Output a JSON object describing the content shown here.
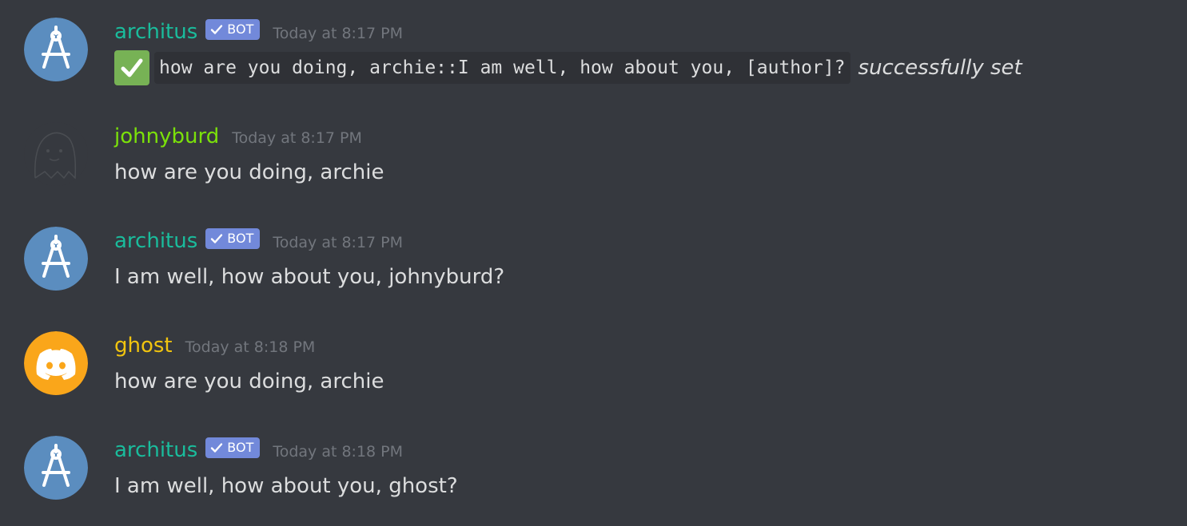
{
  "colors": {
    "background": "#36393f",
    "architus": "#1abc9c",
    "johnyburd": "#7be10a",
    "ghost": "#f1c40f",
    "bot_tag": "#7289da",
    "timestamp": "#72767d",
    "avatar_blue": "#5b8dbf",
    "avatar_orange": "#faa61a"
  },
  "messages": [
    {
      "author": "architus",
      "bot_tag": "BOT",
      "timestamp": "Today at 8:17 PM",
      "avatar_icon": "compass-icon",
      "code": "how are you doing, archie::I am well, how about you, [author]?",
      "suffix": "successfully set",
      "emoji": "white-check-mark-icon"
    },
    {
      "author": "johnyburd",
      "timestamp": "Today at 8:17 PM",
      "avatar_icon": "ghost-sketch-icon",
      "text": "how are you doing, archie"
    },
    {
      "author": "architus",
      "bot_tag": "BOT",
      "timestamp": "Today at 8:17 PM",
      "avatar_icon": "compass-icon",
      "text": "I am well, how about you, johnyburd?"
    },
    {
      "author": "ghost",
      "timestamp": "Today at 8:18 PM",
      "avatar_icon": "discord-logo-icon",
      "text": "how are you doing, archie"
    },
    {
      "author": "architus",
      "bot_tag": "BOT",
      "timestamp": "Today at 8:18 PM",
      "avatar_icon": "compass-icon",
      "text": "I am well, how about you, ghost?"
    }
  ]
}
